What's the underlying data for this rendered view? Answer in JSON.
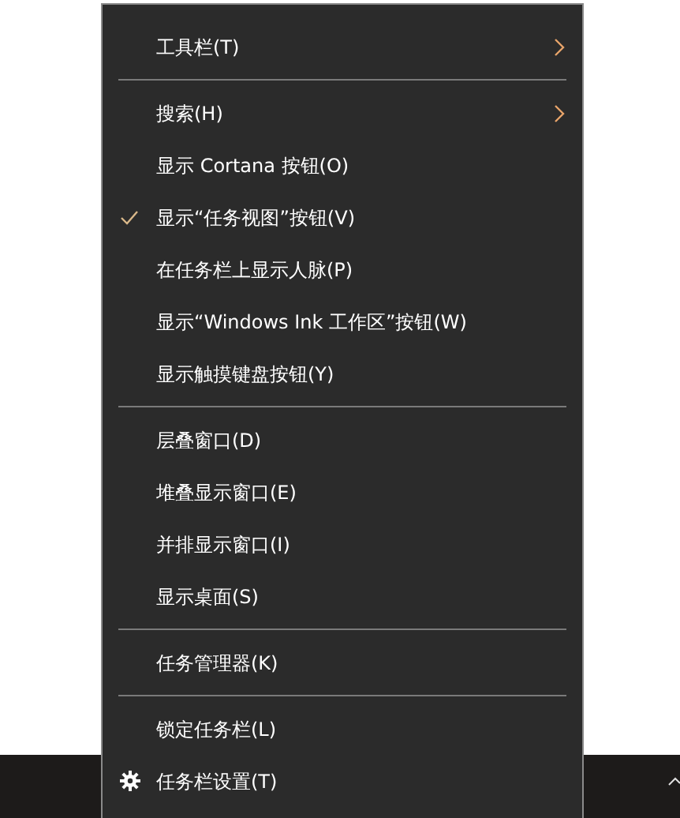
{
  "context_menu": {
    "sections": [
      {
        "items": [
          {
            "label": "工具栏(T)",
            "kind": "submenu",
            "checked": false
          }
        ]
      },
      {
        "items": [
          {
            "label": "搜索(H)",
            "kind": "submenu",
            "checked": false
          },
          {
            "label": "显示 Cortana 按钮(O)",
            "kind": "plain",
            "checked": false
          },
          {
            "label": "显示“任务视图”按钮(V)",
            "kind": "plain",
            "checked": true
          },
          {
            "label": "在任务栏上显示人脉(P)",
            "kind": "plain",
            "checked": false
          },
          {
            "label": "显示“Windows Ink 工作区”按钮(W)",
            "kind": "plain",
            "checked": false
          },
          {
            "label": "显示触摸键盘按钮(Y)",
            "kind": "plain",
            "checked": false
          }
        ]
      },
      {
        "items": [
          {
            "label": "层叠窗口(D)",
            "kind": "plain",
            "checked": false
          },
          {
            "label": "堆叠显示窗口(E)",
            "kind": "plain",
            "checked": false
          },
          {
            "label": "并排显示窗口(I)",
            "kind": "plain",
            "checked": false
          },
          {
            "label": "显示桌面(S)",
            "kind": "plain",
            "checked": false
          }
        ]
      },
      {
        "items": [
          {
            "label": "任务管理器(K)",
            "kind": "plain",
            "checked": false
          }
        ]
      },
      {
        "items": [
          {
            "label": "锁定任务栏(L)",
            "kind": "plain",
            "checked": false
          },
          {
            "label": "任务栏设置(T)",
            "kind": "settings",
            "checked": false
          }
        ]
      }
    ]
  }
}
